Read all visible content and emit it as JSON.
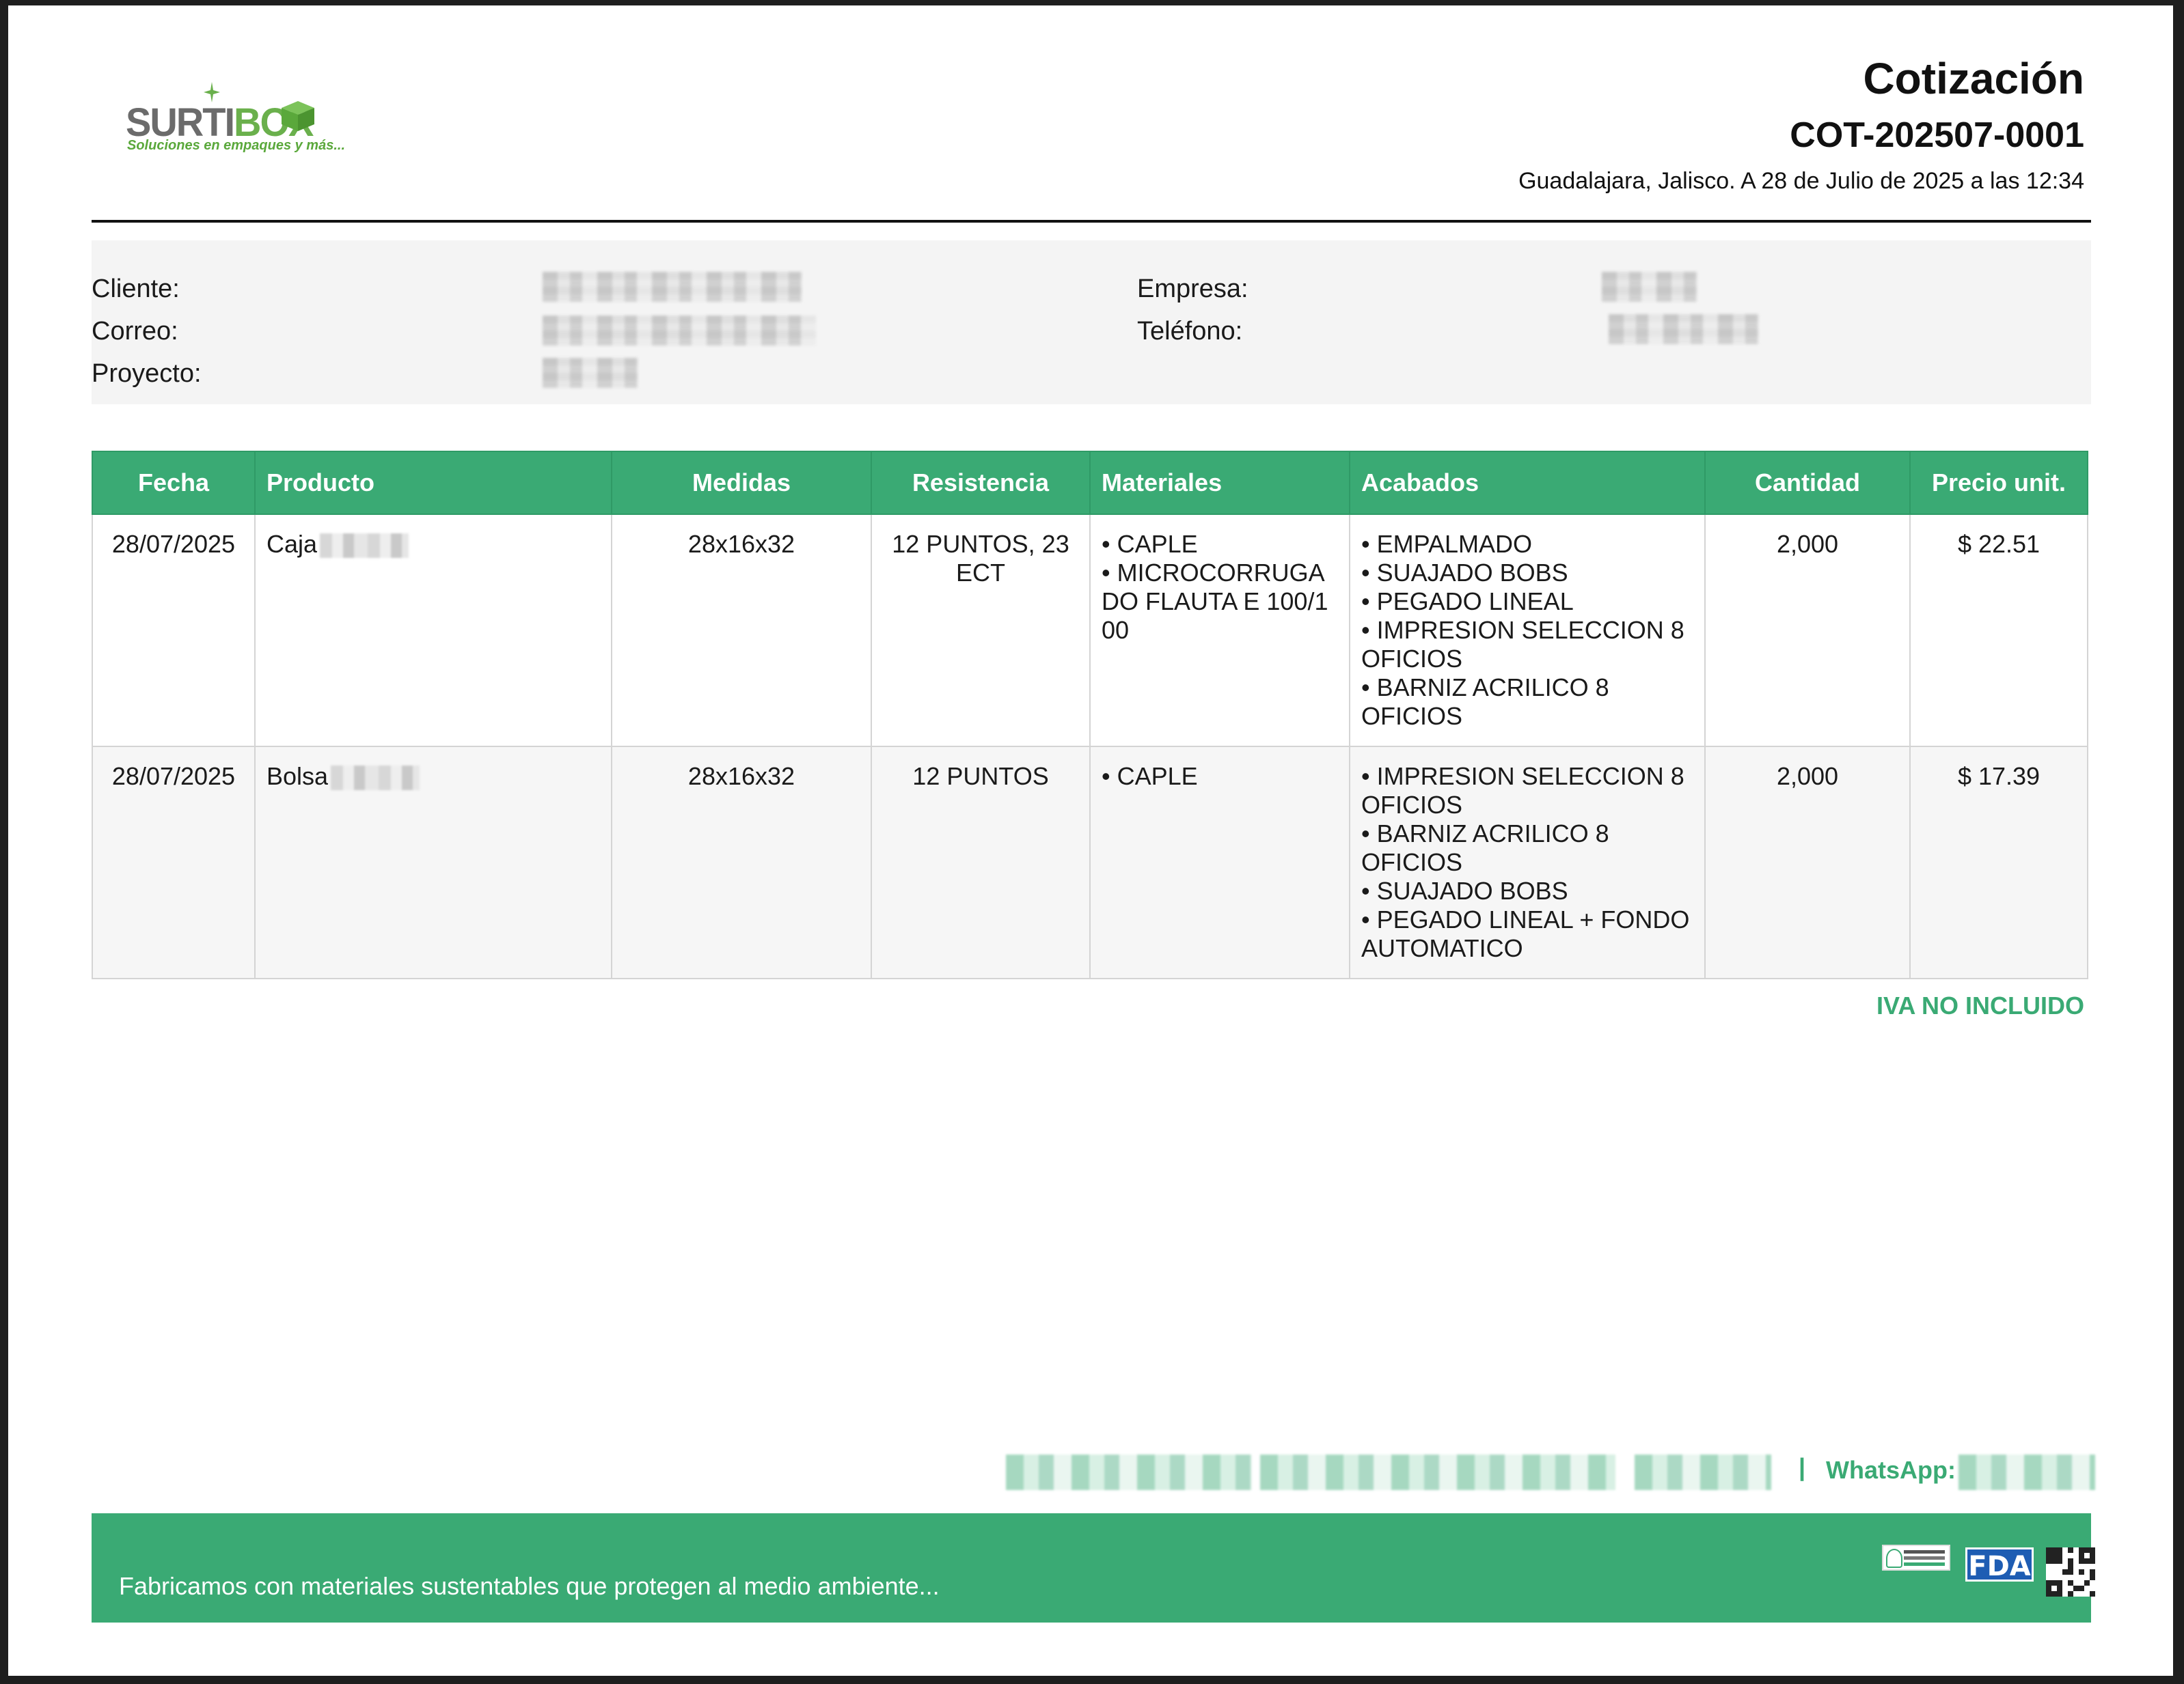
{
  "colors": {
    "accent": "#3aaa74",
    "logo_gray": "#6b6b6b",
    "logo_green": "#6ab04c",
    "fda_blue": "#1e5db3"
  },
  "logo": {
    "brand_main": "SURTI",
    "brand_box": "BOX",
    "tagline": "Soluciones en empaques y más..."
  },
  "header": {
    "title": "Cotización",
    "number": "COT-202507-0001",
    "place_date": "Guadalajara, Jalisco. A 28 de Julio de 2025 a las 12:34"
  },
  "info": {
    "cliente_label": "Cliente:",
    "correo_label": "Correo:",
    "proyecto_label": "Proyecto:",
    "empresa_label": "Empresa:",
    "telefono_label": "Teléfono:"
  },
  "table": {
    "headers": [
      "Fecha",
      "Producto",
      "Medidas",
      "Resistencia",
      "Materiales",
      "Acabados",
      "Cantidad",
      "Precio unit."
    ],
    "rows": [
      {
        "fecha": "28/07/2025",
        "producto": "Caja",
        "medidas": "28x16x32",
        "resistencia": "12 PUNTOS, 23 ECT",
        "materiales": [
          "CAPLE",
          "MICROCORRUGADO FLAUTA E 100/100"
        ],
        "acabados": [
          "EMPALMADO",
          "SUAJADO BOBS",
          "PEGADO LINEAL",
          "IMPRESION SELECCION 8 OFICIOS",
          "BARNIZ ACRILICO 8 OFICIOS"
        ],
        "cantidad": "2,000",
        "precio": "$ 22.51"
      },
      {
        "fecha": "28/07/2025",
        "producto": "Bolsa",
        "medidas": "28x16x32",
        "resistencia": "12 PUNTOS",
        "materiales": [
          "CAPLE"
        ],
        "acabados": [
          "IMPRESION SELECCION 8 OFICIOS",
          "BARNIZ ACRILICO 8 OFICIOS",
          "SUAJADO BOBS",
          "PEGADO LINEAL + FONDO AUTOMATICO"
        ],
        "cantidad": "2,000",
        "precio": "$ 17.39"
      }
    ]
  },
  "note": "IVA NO INCLUIDO",
  "contact": {
    "separator": "|",
    "whatsapp_label": "WhatsApp:"
  },
  "footer": {
    "text": "Fabricamos con materiales sustentables que protegen al medio ambiente...",
    "badges": {
      "fda": "FDA"
    }
  }
}
